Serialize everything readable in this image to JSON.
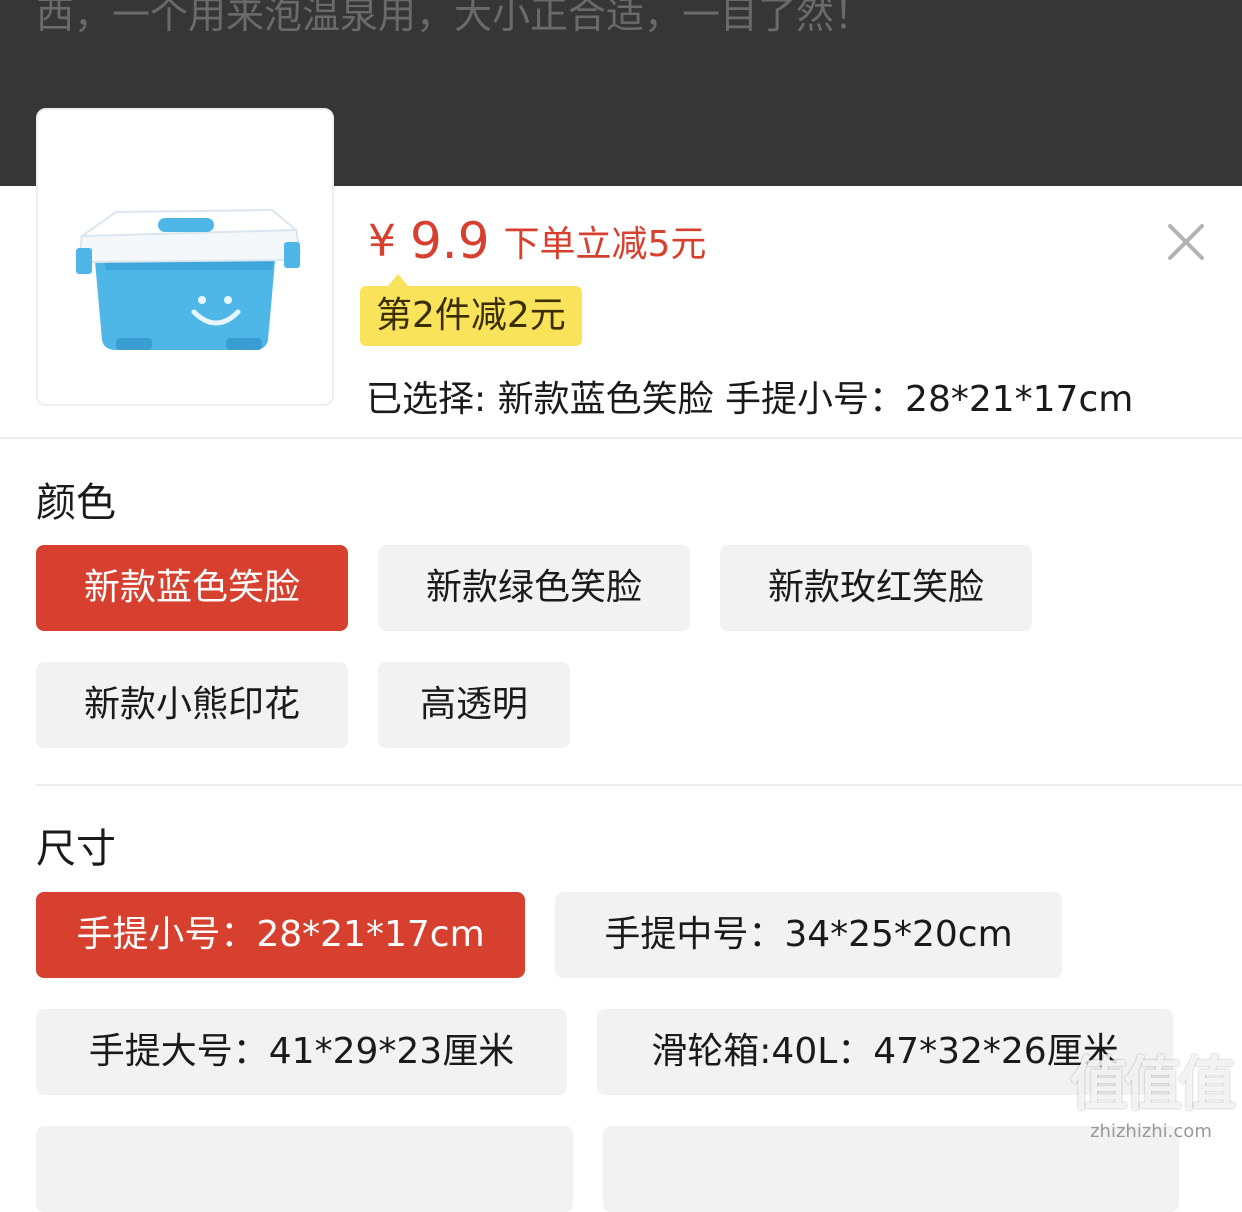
{
  "background_text": "西，一个用来泡温泉用，大小正合适，一目了然！",
  "product": {
    "currency": "¥",
    "price": "9.9",
    "discount_text": "下单立减5元",
    "promo_badge": "第2件减2元",
    "selected_label": "已选择:",
    "selected_value": "新款蓝色笑脸 手提小号：28*21*17cm"
  },
  "color_section": {
    "title": "颜色",
    "options": [
      "新款蓝色笑脸",
      "新款绿色笑脸",
      "新款玫红笑脸",
      "新款小熊印花",
      "高透明"
    ],
    "selected_index": 0
  },
  "size_section": {
    "title": "尺寸",
    "options": [
      "手提小号：28*21*17cm",
      "手提中号：34*25*20cm",
      "手提大号：41*29*23厘米",
      "滑轮箱:40L：47*32*26厘米"
    ],
    "selected_index": 0
  },
  "watermark": {
    "logo": "值值值",
    "url": "zhizhizhi.com"
  },
  "colors": {
    "accent": "#d7402e",
    "promo_bg": "#f9e35a",
    "chip_bg": "#f2f2f2",
    "overlay": "#363636"
  },
  "icons": {
    "close": "close-icon",
    "product": "product-thumbnail"
  }
}
